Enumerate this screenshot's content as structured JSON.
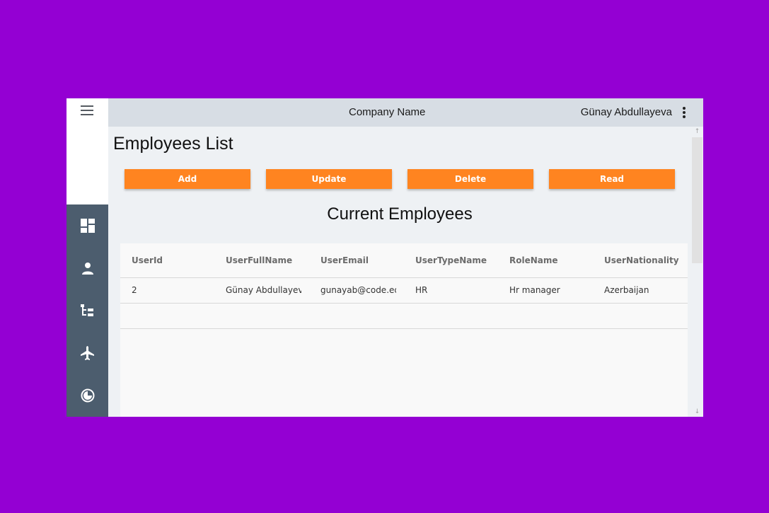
{
  "header": {
    "company_name": "Company Name",
    "user_name": "Günay Abdullayeva"
  },
  "sidebar": {
    "items": [
      {
        "icon": "dashboard-icon"
      },
      {
        "icon": "person-icon"
      },
      {
        "icon": "org-chart-icon"
      },
      {
        "icon": "airplane-icon"
      },
      {
        "icon": "pie-icon"
      }
    ]
  },
  "page": {
    "title": "Employees List",
    "section_title": "Current Employees"
  },
  "actions": {
    "add": "Add",
    "update": "Update",
    "delete": "Delete",
    "read": "Read"
  },
  "table": {
    "columns": [
      "UserId",
      "UserFullName",
      "UserEmail",
      "UserTypeName",
      "RoleName",
      "UserNationality"
    ],
    "rows": [
      [
        "2",
        "Günay Abdullayeva",
        "gunayab@code.ed",
        "HR",
        "Hr manager",
        "Azerbaijan"
      ]
    ]
  },
  "colors": {
    "accent": "#ff8420",
    "sidebar": "#4c5d6e",
    "header": "#d7dde4",
    "background": "#9400d3"
  }
}
